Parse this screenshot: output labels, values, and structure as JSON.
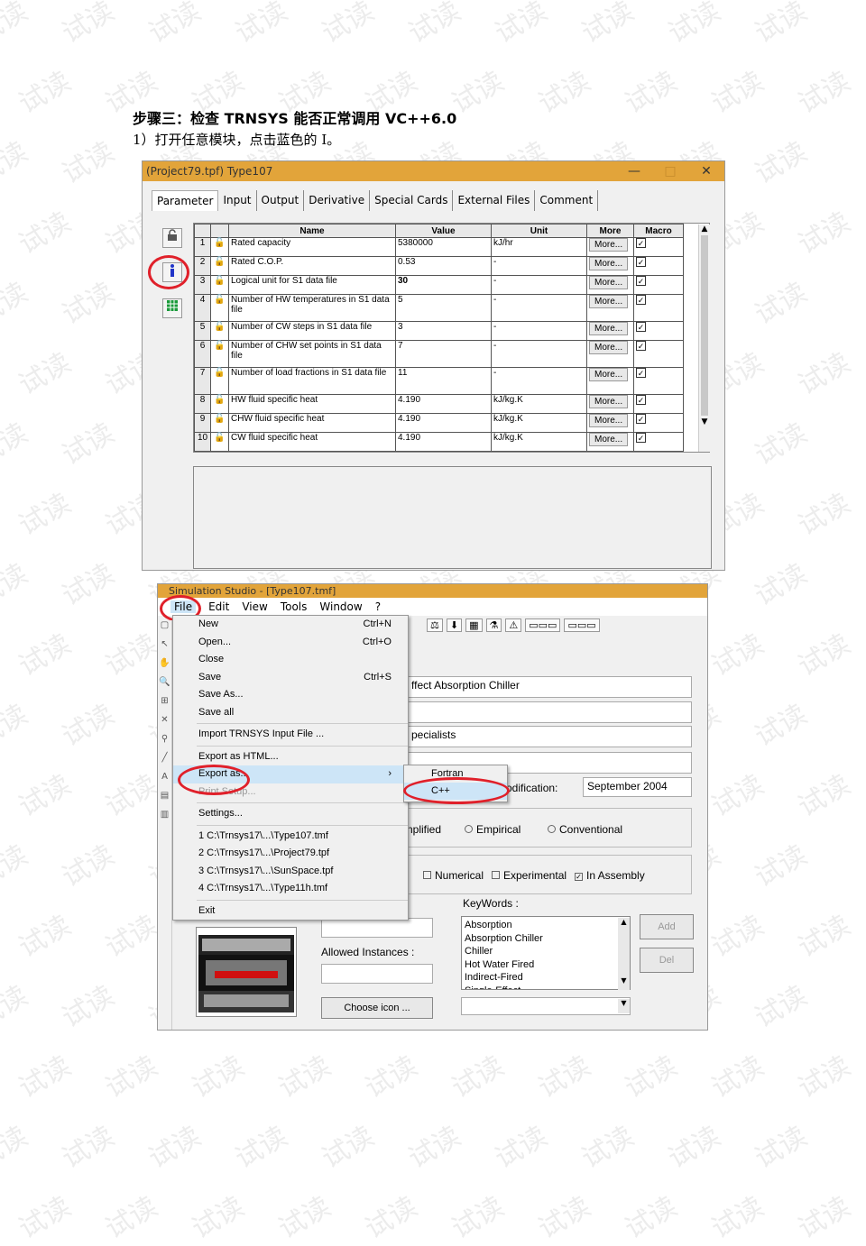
{
  "heading": "步骤三：检查 TRNSYS 能否正常调用 VC++6.0",
  "step": "1）打开任意模块，点击蓝色的 I。",
  "watermark": "试读",
  "window1": {
    "title": "(Project79.tpf) Type107",
    "minimize": "—",
    "maximize": "□",
    "close": "✕",
    "tabs": [
      "Parameter",
      "Input",
      "Output",
      "Derivative",
      "Special Cards",
      "External Files",
      "Comment"
    ],
    "columns": [
      "Name",
      "Value",
      "Unit",
      "More",
      "Macro"
    ],
    "more_label": "More...",
    "rows": [
      {
        "idx": "1",
        "name": "Rated capacity",
        "value": "5380000",
        "unit": "kJ/hr"
      },
      {
        "idx": "2",
        "name": "Rated C.O.P.",
        "value": "0.53",
        "unit": "-"
      },
      {
        "idx": "3",
        "name": "Logical unit for S1 data file",
        "value": "30",
        "unit": "-"
      },
      {
        "idx": "4",
        "name": "Number of HW temperatures in S1 data file",
        "value": "5",
        "unit": "-"
      },
      {
        "idx": "5",
        "name": "Number of CW steps in S1 data file",
        "value": "3",
        "unit": "-"
      },
      {
        "idx": "6",
        "name": "Number of CHW set points in S1 data file",
        "value": "7",
        "unit": "-"
      },
      {
        "idx": "7",
        "name": "Number of load fractions in S1 data file",
        "value": "11",
        "unit": "-"
      },
      {
        "idx": "8",
        "name": "HW fluid specific heat",
        "value": "4.190",
        "unit": "kJ/kg.K"
      },
      {
        "idx": "9",
        "name": "CHW fluid specific heat",
        "value": "4.190",
        "unit": "kJ/kg.K"
      },
      {
        "idx": "10",
        "name": "CW fluid specific heat",
        "value": "4.190",
        "unit": "kJ/kg.K"
      }
    ],
    "side_icons": [
      "lock-icon",
      "info-icon",
      "grid-icon"
    ]
  },
  "window2": {
    "title": "Simulation Studio - [Type107.tmf]",
    "menus": [
      "File",
      "Edit",
      "View",
      "Tools",
      "Window",
      "?"
    ],
    "file_menu": {
      "items": [
        {
          "label": "New",
          "shortcut": "Ctrl+N"
        },
        {
          "label": "Open...",
          "shortcut": "Ctrl+O"
        },
        {
          "label": "Close",
          "shortcut": ""
        },
        {
          "label": "Save",
          "shortcut": "Ctrl+S"
        },
        {
          "label": "Save As...",
          "shortcut": ""
        },
        {
          "label": "Save all",
          "shortcut": ""
        }
      ],
      "import": "Import TRNSYS Input File ...",
      "export_html": "Export as HTML...",
      "export_as": "Export as...",
      "print_setup": "Print Setup...",
      "settings": "Settings...",
      "recent": [
        "1 C:\\Trnsys17\\...\\Type107.tmf",
        "2 C:\\Trnsys17\\...\\Project79.tpf",
        "3 C:\\Trnsys17\\...\\SunSpace.tpf",
        "4 C:\\Trnsys17\\...\\Type11h.tmf"
      ],
      "exit": "Exit",
      "submenu_arrow": "›"
    },
    "export_submenu": [
      "Fortran",
      "C++"
    ],
    "fields": {
      "description": "ffect Absorption Chiller",
      "author": "pecialists",
      "modification_label": "odification:",
      "modification_value": "September 2004"
    },
    "radios": [
      "nplified",
      "Empirical",
      "Conventional"
    ],
    "checks": [
      {
        "label": "Numerical",
        "checked": false
      },
      {
        "label": "Experimental",
        "checked": false
      },
      {
        "label": "In Assembly",
        "checked": true
      }
    ],
    "keywords_label": "KeyWords :",
    "keywords": [
      "Absorption",
      "Absorption Chiller",
      "Chiller",
      "Hot Water Fired",
      "Indirect-Fired",
      "Single-Effect"
    ],
    "add_label": "Add",
    "del_label": "Del",
    "allowed_instances_label": "Allowed Instances :",
    "choose_icon_label": "Choose icon ..."
  },
  "colors": {
    "title_bar": "#e2a43a",
    "highlight_circle": "#e0202a",
    "menu_selected": "#cde5f7"
  }
}
